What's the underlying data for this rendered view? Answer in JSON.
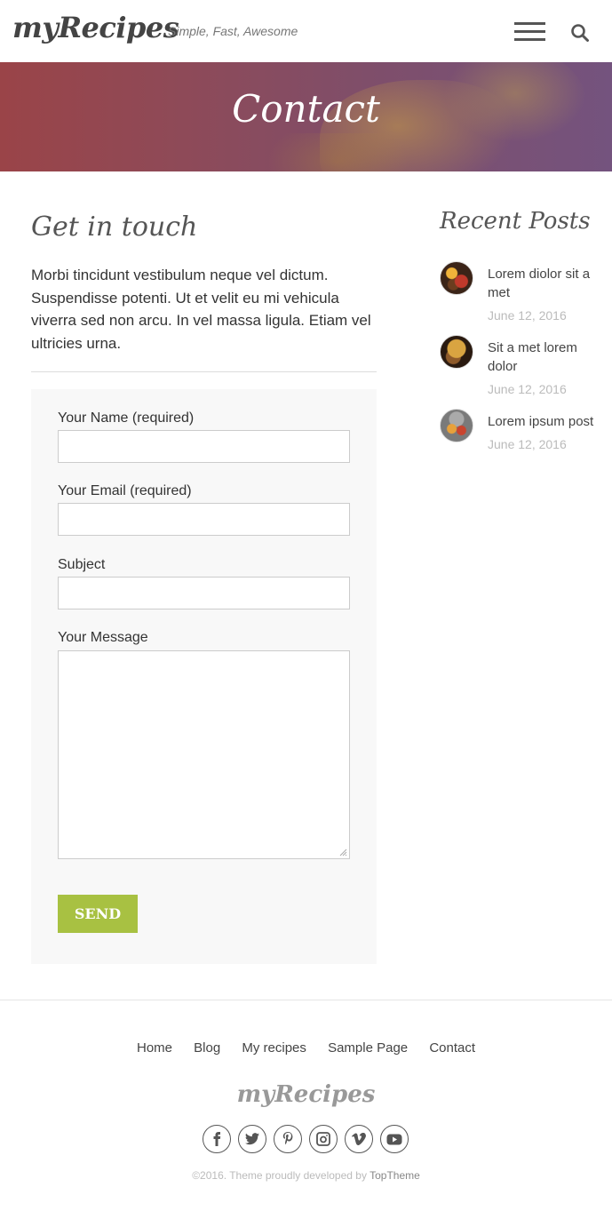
{
  "header": {
    "logo": "myRecipes",
    "tagline": "Simple, Fast, Awesome",
    "menu_icon": "hamburger-menu-icon",
    "search_icon": "search-icon"
  },
  "banner": {
    "title": "Contact"
  },
  "main": {
    "title": "Get in touch",
    "intro": "Morbi tincidunt vestibulum neque vel dictum. Suspendisse potenti. Ut et velit eu mi vehicula viverra sed non arcu. In vel massa ligula. Etiam vel ultricies urna.",
    "form": {
      "name_label": "Your Name (required)",
      "name_value": "",
      "email_label": "Your Email (required)",
      "email_value": "",
      "subject_label": "Subject",
      "subject_value": "",
      "message_label": "Your Message",
      "message_value": "",
      "send_label": "SEND"
    }
  },
  "sidebar": {
    "title": "Recent Posts",
    "posts": [
      {
        "title": "Lorem diolor sit a met",
        "date": "June 12, 2016"
      },
      {
        "title": "Sit a met lorem dolor",
        "date": "June 12, 2016"
      },
      {
        "title": "Lorem ipsum post",
        "date": "June 12, 2016"
      }
    ]
  },
  "footer": {
    "nav": [
      "Home",
      "Blog",
      "My recipes",
      "Sample Page",
      "Contact"
    ],
    "logo": "myRecipes",
    "social": [
      "facebook-icon",
      "twitter-icon",
      "pinterest-icon",
      "instagram-icon",
      "vimeo-icon",
      "youtube-icon"
    ],
    "copyright_prefix": "©2016. Theme proudly developed by",
    "developer": "TopTheme"
  },
  "colors": {
    "accent": "#a8c142",
    "banner_left": "#9a4448",
    "banner_right": "#74537e"
  }
}
